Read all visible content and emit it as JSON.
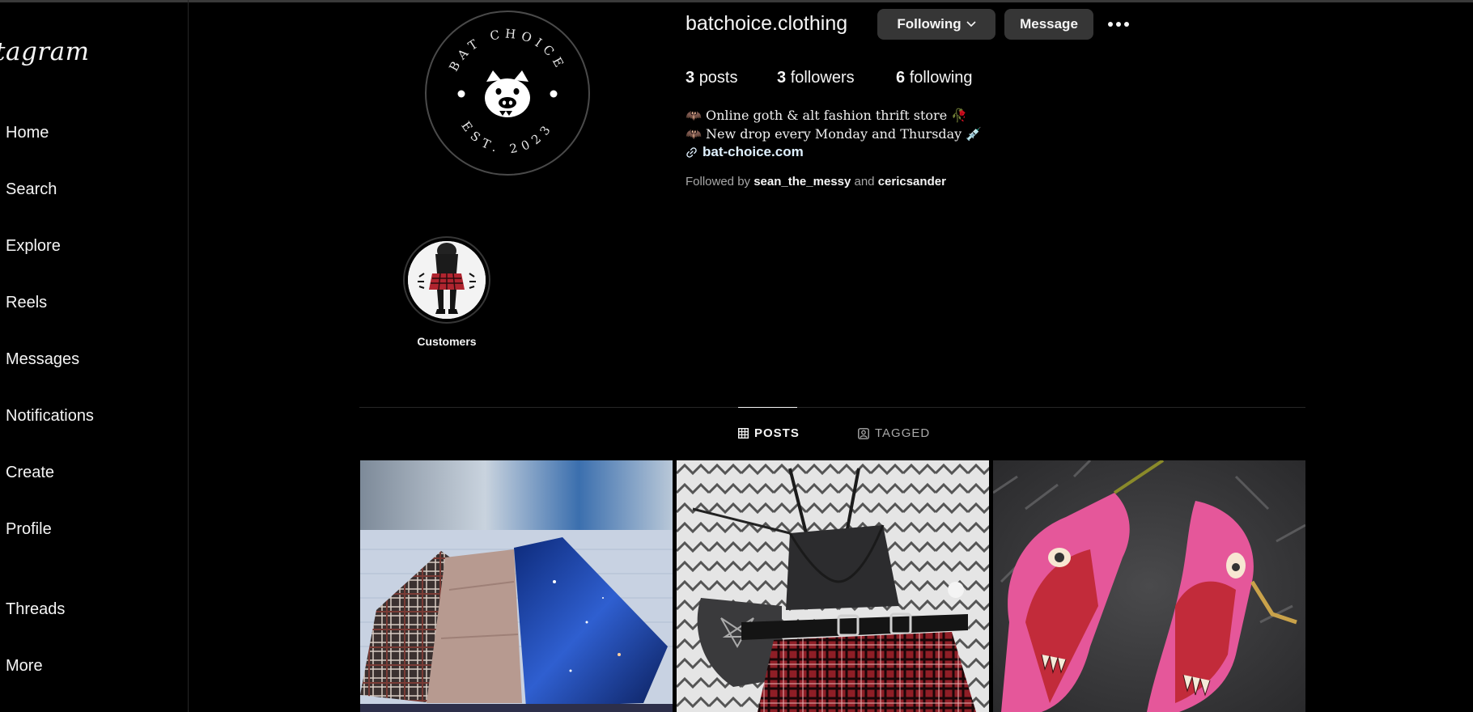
{
  "sidebar": {
    "logo": "tagram",
    "items": [
      {
        "label": "Home"
      },
      {
        "label": "Search"
      },
      {
        "label": "Explore"
      },
      {
        "label": "Reels"
      },
      {
        "label": "Messages"
      },
      {
        "label": "Notifications"
      },
      {
        "label": "Create"
      },
      {
        "label": "Profile"
      },
      {
        "label": "Threads"
      },
      {
        "label": "More"
      }
    ]
  },
  "profile": {
    "username": "batchoice.clothing",
    "avatar_text_top": "BAT CHOICE",
    "avatar_text_bottom": "EST. 2023",
    "following_button": "Following",
    "message_button": "Message",
    "stats": {
      "posts_count": "3",
      "posts_label": "posts",
      "followers_count": "3",
      "followers_label": "followers",
      "following_count": "6",
      "following_label": "following"
    },
    "bio": {
      "line1": "🦇 Online goth & alt fashion thrift store 🥀",
      "line2": "🦇 New drop every Monday and Thursday 💉",
      "link": "bat-choice.com"
    },
    "followed_by": {
      "prefix": "Followed by",
      "user1": "sean_the_messy",
      "conjunction": "and",
      "user2": "cericsander"
    }
  },
  "highlights": [
    {
      "label": "Customers"
    }
  ],
  "tabs": [
    {
      "label": "POSTS",
      "active": true
    },
    {
      "label": "TAGGED",
      "active": false
    }
  ],
  "posts": [
    {
      "subject": "skirts-flatlay"
    },
    {
      "subject": "goth-outfit-flatlay"
    },
    {
      "subject": "zombie-heels"
    }
  ],
  "colors": {
    "background": "#000000",
    "button": "#363636",
    "link": "#e0f1ff",
    "secondary_text": "#a8a8a8"
  }
}
